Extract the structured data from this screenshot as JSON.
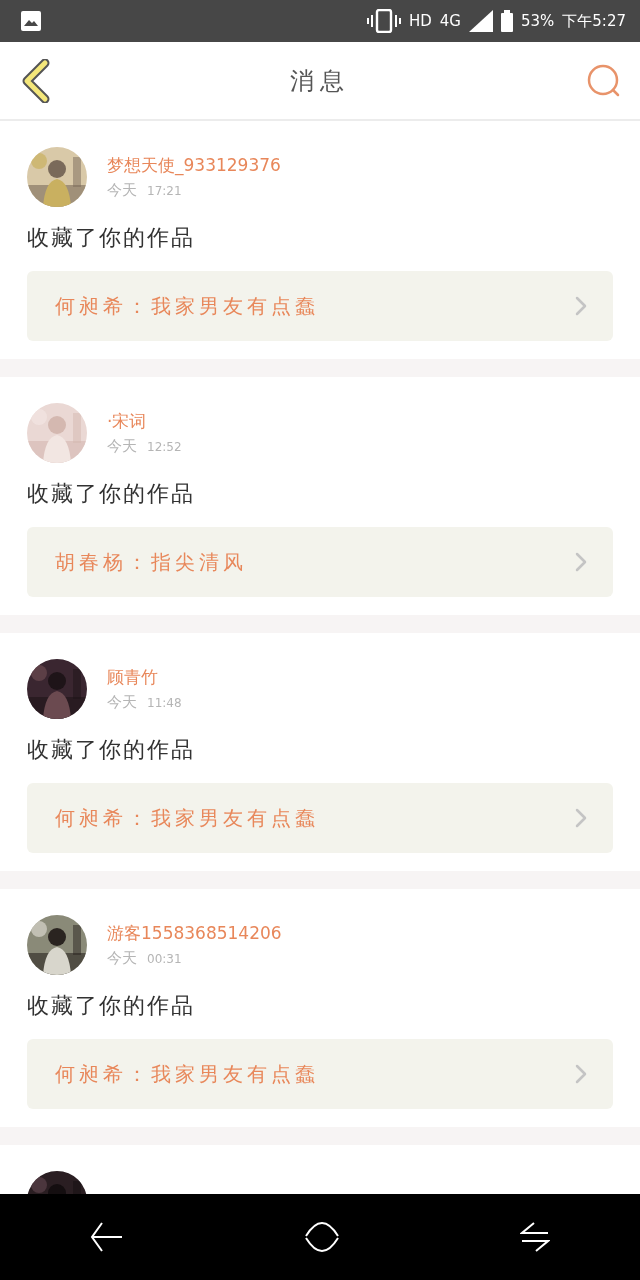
{
  "status_bar": {
    "network": "HD",
    "signal_type": "4G",
    "battery": "53%",
    "time": "下午5:27"
  },
  "header": {
    "title": "消息"
  },
  "messages": [
    {
      "user": "梦想天使_933129376",
      "date": "今天",
      "time": "17:21",
      "action": "收藏了你的作品",
      "quote": "何昶希：我家男友有点蠢"
    },
    {
      "user": "·宋词",
      "date": "今天",
      "time": "12:52",
      "action": "收藏了你的作品",
      "quote": "胡春杨：指尖清风"
    },
    {
      "user": "顾青竹",
      "date": "今天",
      "time": "11:48",
      "action": "收藏了你的作品",
      "quote": "何昶希：我家男友有点蠢"
    },
    {
      "user": "游客1558368514206",
      "date": "今天",
      "time": "00:31",
      "action": "收藏了你的作品",
      "quote": "何昶希：我家男友有点蠢"
    },
    {
      "avatar": {
        "kind": "picture"
      }
    }
  ]
}
